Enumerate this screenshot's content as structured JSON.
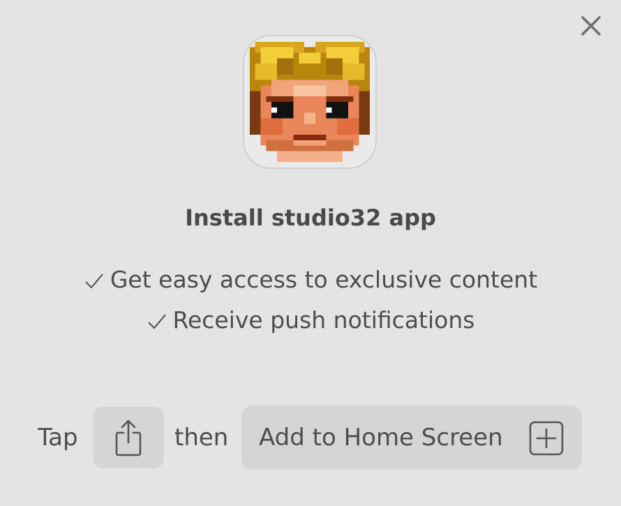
{
  "dialog": {
    "close_icon": "close-icon",
    "app_icon": "pixel-art-face-icon",
    "title": "Install studio32 app",
    "features": [
      "Get easy access to exclusive content",
      "Receive push notifications"
    ],
    "check_icon": "checkmark-icon"
  },
  "instruction": {
    "tap_label": "Tap",
    "share_icon": "share-icon",
    "then_label": "then",
    "add_home_label": "Add to Home Screen",
    "add_icon": "plus-square-icon"
  },
  "colors": {
    "background": "#e4e4e4",
    "button_background": "#d5d5d5",
    "text": "#4d4d4d"
  }
}
